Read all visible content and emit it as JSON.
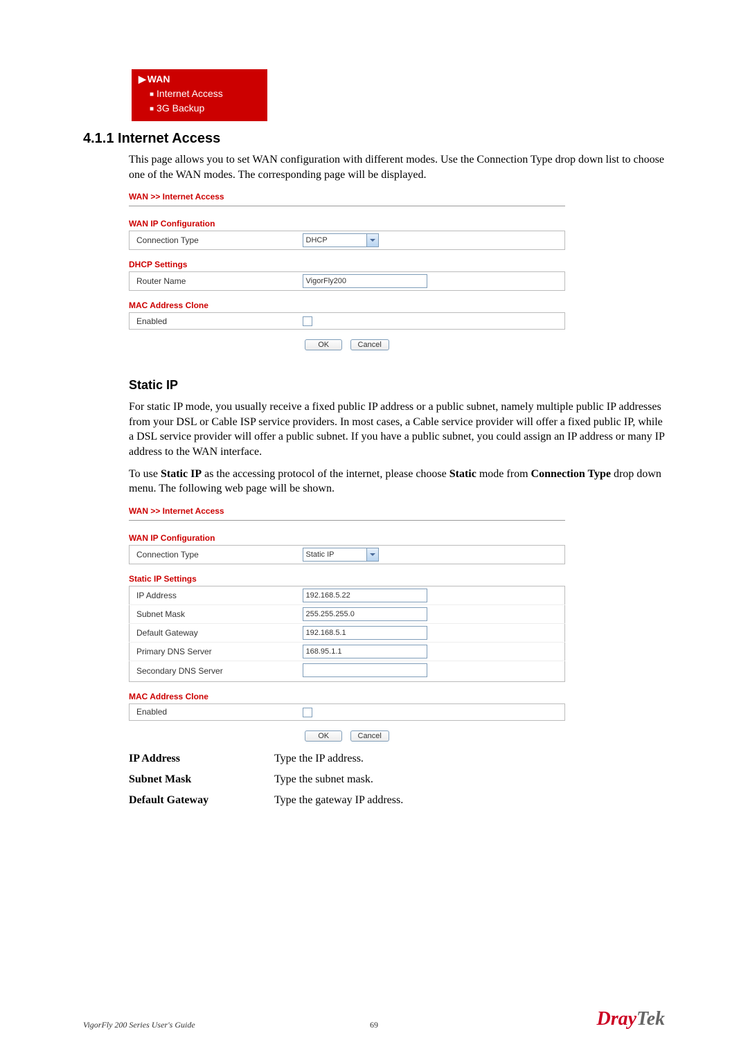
{
  "menu": {
    "head": "WAN",
    "items": [
      "Internet Access",
      "3G Backup"
    ]
  },
  "section_number": "4.1.1 Internet Access",
  "para1": "This page allows you to set WAN configuration with different modes. Use the Connection Type drop down list to choose one of the WAN modes. The corresponding page will be displayed.",
  "panel1": {
    "breadcrumb": "WAN >> Internet Access",
    "group1": "WAN IP Configuration",
    "conn_type_label": "Connection Type",
    "conn_type_value": "DHCP",
    "group2": "DHCP Settings",
    "router_name_label": "Router Name",
    "router_name_value": "VigorFly200",
    "group3": "MAC Address Clone",
    "enabled_label": "Enabled",
    "ok": "OK",
    "cancel": "Cancel"
  },
  "subsection": "Static IP",
  "para2": "For static IP mode, you usually receive a fixed public IP address or a public subnet, namely multiple public IP addresses from your DSL or Cable ISP service providers. In most cases, a Cable service provider will offer a fixed public IP, while a DSL service provider will offer a public subnet. If you have a public subnet, you could assign an IP address or many IP address to the WAN interface.",
  "para3_a": "To use ",
  "para3_b": "Static IP",
  "para3_c": " as the accessing protocol of the internet, please choose ",
  "para3_d": "Static",
  "para3_e": " mode from ",
  "para3_f": "Connection Type",
  "para3_g": " drop down menu. The following web page will be shown.",
  "panel2": {
    "breadcrumb": "WAN >> Internet Access",
    "group1": "WAN IP Configuration",
    "conn_type_label": "Connection Type",
    "conn_type_value": "Static IP",
    "group2": "Static IP Settings",
    "ip_label": "IP Address",
    "ip_value": "192.168.5.22",
    "mask_label": "Subnet Mask",
    "mask_value": "255.255.255.0",
    "gw_label": "Default Gateway",
    "gw_value": "192.168.5.1",
    "dns1_label": "Primary DNS Server",
    "dns1_value": "168.95.1.1",
    "dns2_label": "Secondary DNS Server",
    "dns2_value": "",
    "group3": "MAC Address Clone",
    "enabled_label": "Enabled",
    "ok": "OK",
    "cancel": "Cancel"
  },
  "defs": [
    {
      "term": "IP Address",
      "def": "Type the IP address."
    },
    {
      "term": "Subnet Mask",
      "def": "Type the subnet mask."
    },
    {
      "term": "Default Gateway",
      "def": "Type the gateway IP address."
    }
  ],
  "footer": {
    "guide": "VigorFly 200 Series User's Guide",
    "page": "69",
    "brand_a": "Dray",
    "brand_b": "Tek"
  }
}
